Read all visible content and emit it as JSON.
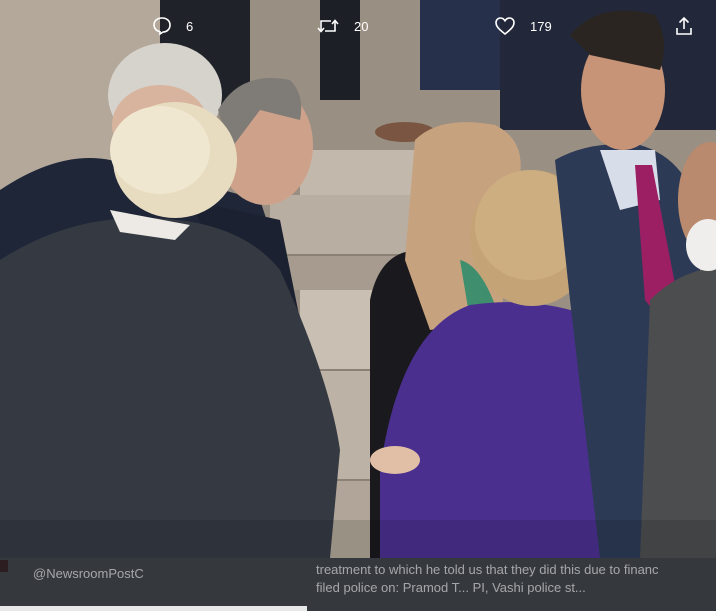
{
  "tweet": {
    "media_alt": "",
    "overlay": {
      "handle": "@NewsroomPostC",
      "caption_line1": "treatment to which he told us that they did this due to financ",
      "caption_line2": "filed police on: Pramod T... PI, Vashi police st..."
    },
    "actions": {
      "reply": {
        "icon": "reply-icon",
        "count": "6"
      },
      "retweet": {
        "icon": "retweet-icon",
        "count": "20"
      },
      "like": {
        "icon": "heart-icon",
        "count": "179"
      },
      "share": {
        "icon": "share-icon"
      }
    }
  },
  "colors": {
    "action_bar": "#14181e",
    "text": "#ffffff",
    "jacket_purple": "#4a2f8f",
    "steps": "#b9aea2"
  }
}
